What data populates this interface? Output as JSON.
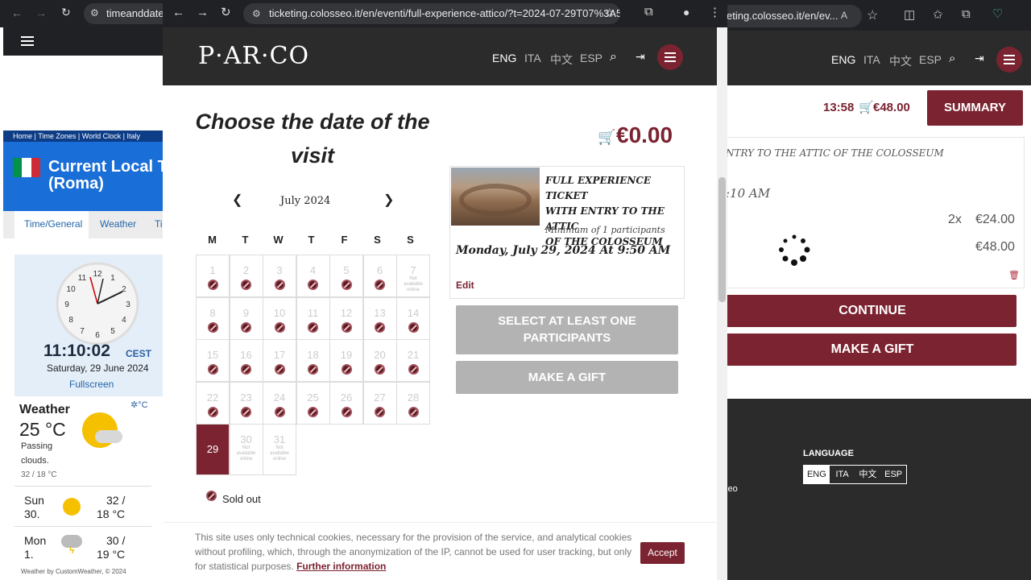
{
  "left_window": {
    "tab_title": "timeanddate",
    "breadcrumb": [
      "Home",
      "Time Zones",
      "World Clock",
      "Italy"
    ],
    "heading_line1": "Current Local T",
    "heading_line2": "(Roma)",
    "tabs": [
      "Time/General",
      "Weather",
      "Ti"
    ],
    "clock_numbers": [
      "12",
      "1",
      "2",
      "3",
      "4",
      "5",
      "6",
      "7",
      "8",
      "9",
      "10",
      "11"
    ],
    "time": "11:10:02",
    "timezone": "CEST",
    "date": "Saturday, 29 June 2024",
    "fullscreen": "Fullscreen",
    "weather_title": "Weather",
    "unit": "°C",
    "temp": "25 °C",
    "condition_line1": "Passing",
    "condition_line2": "clouds.",
    "range": "32 / 18 °C",
    "forecast": [
      {
        "day": "Sun",
        "date": "30.",
        "high": "32 /",
        "low": "18 °C",
        "icon": "sun-icon"
      },
      {
        "day": "Mon",
        "date": "1.",
        "high": "30 /",
        "low": "19 °C",
        "icon": "storm-icon"
      }
    ],
    "credit": "Weather by CustomWeather, © 2024"
  },
  "main_window": {
    "url": "ticketing.colosseo.it/en/eventi/full-experience-attico/?t=2024-07-29T07%3A50...",
    "logo": "P·AR·CO",
    "languages": [
      "ENG",
      "ITA",
      "中文",
      "ESP"
    ],
    "heading_line1": "Choose the date of the",
    "heading_line2": "visit",
    "cart_total": "€0.00",
    "calendar": {
      "month": "July 2024",
      "weekdays": [
        "M",
        "T",
        "W",
        "T",
        "F",
        "S",
        "S"
      ],
      "not_available_line1": "Not",
      "not_available_line2": "available",
      "not_available_line3": "online",
      "days": [
        "1",
        "2",
        "3",
        "4",
        "5",
        "6",
        "7",
        "8",
        "9",
        "10",
        "11",
        "12",
        "13",
        "14",
        "15",
        "16",
        "17",
        "18",
        "19",
        "20",
        "21",
        "22",
        "23",
        "24",
        "25",
        "26",
        "27",
        "28",
        "29",
        "30",
        "31"
      ],
      "selected": "29"
    },
    "legend_sold_out": "Sold out",
    "product": {
      "title_line1": "FULL EXPERIENCE TICKET",
      "title_line2": "WITH ENTRY TO THE ATTIC",
      "title_line3": "OF THE COLOSSEUM",
      "minimum": "Minimum of 1 participants",
      "datetime": "Monday, July 29, 2024 At 9:50 AM",
      "edit": "Edit"
    },
    "button_select_line1": "SELECT AT LEAST ONE",
    "button_select_line2": "PARTICIPANTS",
    "button_gift": "MAKE A GIFT",
    "cookie_text_line1": "This site uses only technical cookies, necessary for the provision of the service, and analytical cookies",
    "cookie_text_line2": "without profiling, which, through the anonymization of the IP, cannot be used for user tracking, but only",
    "cookie_text_line3": "for statistical purposes.",
    "cookie_link": "Further information",
    "cookie_accept": "Accept"
  },
  "right_window": {
    "url": "eting.colosseo.it/en/ev...",
    "languages": [
      "ENG",
      "ITA",
      "中文",
      "ESP"
    ],
    "timer": "13:58",
    "cart_total": "€48.00",
    "summary_button": "SUMMARY",
    "ticket_title": "NTRY TO THE ATTIC OF THE COLOSSEUM",
    "time": ":10 AM",
    "qty": "2x",
    "unit_price": "€24.00",
    "line_total": "€48.00",
    "continue_button": "CONTINUE",
    "gift_button": "MAKE A GIFT",
    "language_label": "LANGUAGE",
    "footer_langs": [
      "ENG",
      "ITA",
      "中文",
      "ESP"
    ],
    "footer_fragment": "seo"
  },
  "colors": {
    "maroon": "#7b2330",
    "disabled_button": "#b3b3b3",
    "header_dark": "#2b2b2b"
  }
}
